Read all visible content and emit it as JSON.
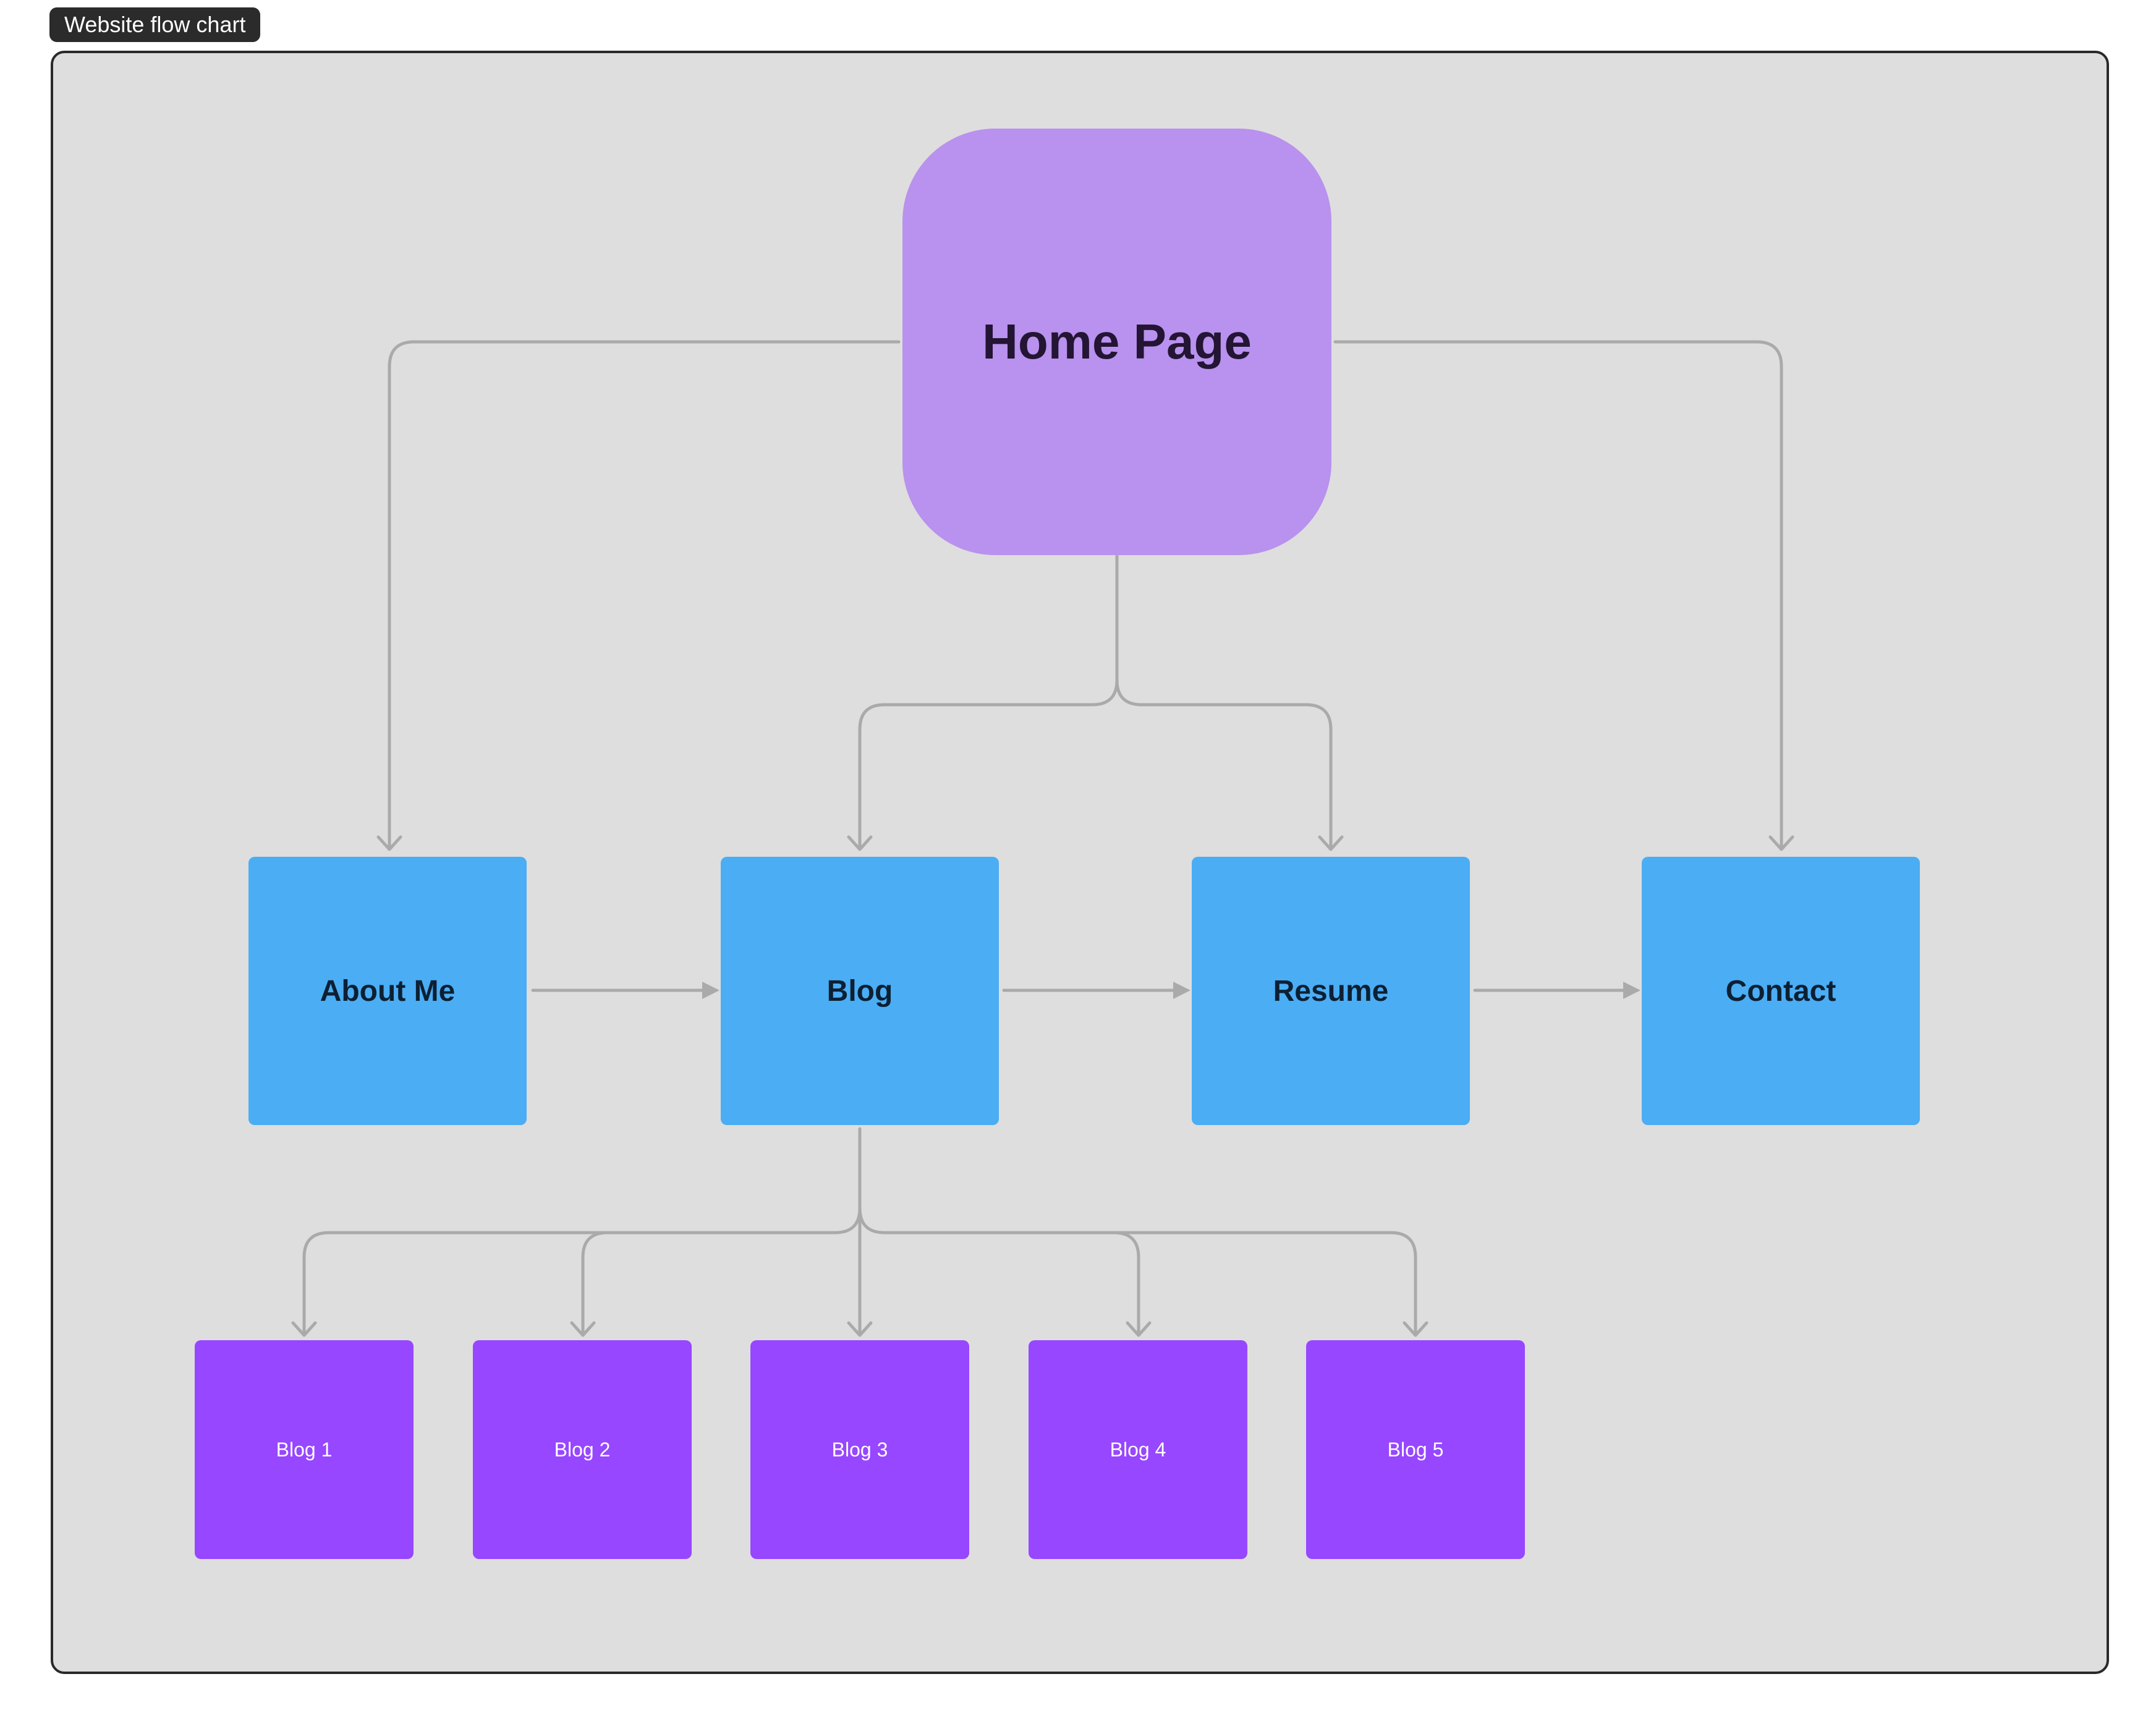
{
  "frame": {
    "label": "Website flow chart",
    "background": "#dedede"
  },
  "nodes": {
    "home": {
      "label": "Home Page",
      "color": "#b991ee"
    },
    "about": {
      "label": "About Me",
      "color": "#4badf4"
    },
    "blog": {
      "label": "Blog",
      "color": "#4badf4"
    },
    "resume": {
      "label": "Resume",
      "color": "#4badf4"
    },
    "contact": {
      "label": "Contact",
      "color": "#4badf4"
    },
    "blog_posts": [
      {
        "label": "Blog 1",
        "color": "#9747ff"
      },
      {
        "label": "Blog 2",
        "color": "#9747ff"
      },
      {
        "label": "Blog 3",
        "color": "#9747ff"
      },
      {
        "label": "Blog 4",
        "color": "#9747ff"
      },
      {
        "label": "Blog 5",
        "color": "#9747ff"
      }
    ]
  },
  "connections": [
    {
      "from": "Home Page",
      "to": "About Me"
    },
    {
      "from": "Home Page",
      "to": "Blog"
    },
    {
      "from": "Home Page",
      "to": "Resume"
    },
    {
      "from": "Home Page",
      "to": "Contact"
    },
    {
      "from": "About Me",
      "to": "Blog"
    },
    {
      "from": "Blog",
      "to": "Resume"
    },
    {
      "from": "Resume",
      "to": "Contact"
    },
    {
      "from": "Blog",
      "to": "Blog 1"
    },
    {
      "from": "Blog",
      "to": "Blog 2"
    },
    {
      "from": "Blog",
      "to": "Blog 3"
    },
    {
      "from": "Blog",
      "to": "Blog 4"
    },
    {
      "from": "Blog",
      "to": "Blog 5"
    }
  ],
  "connector_color": "#aaaaaa"
}
